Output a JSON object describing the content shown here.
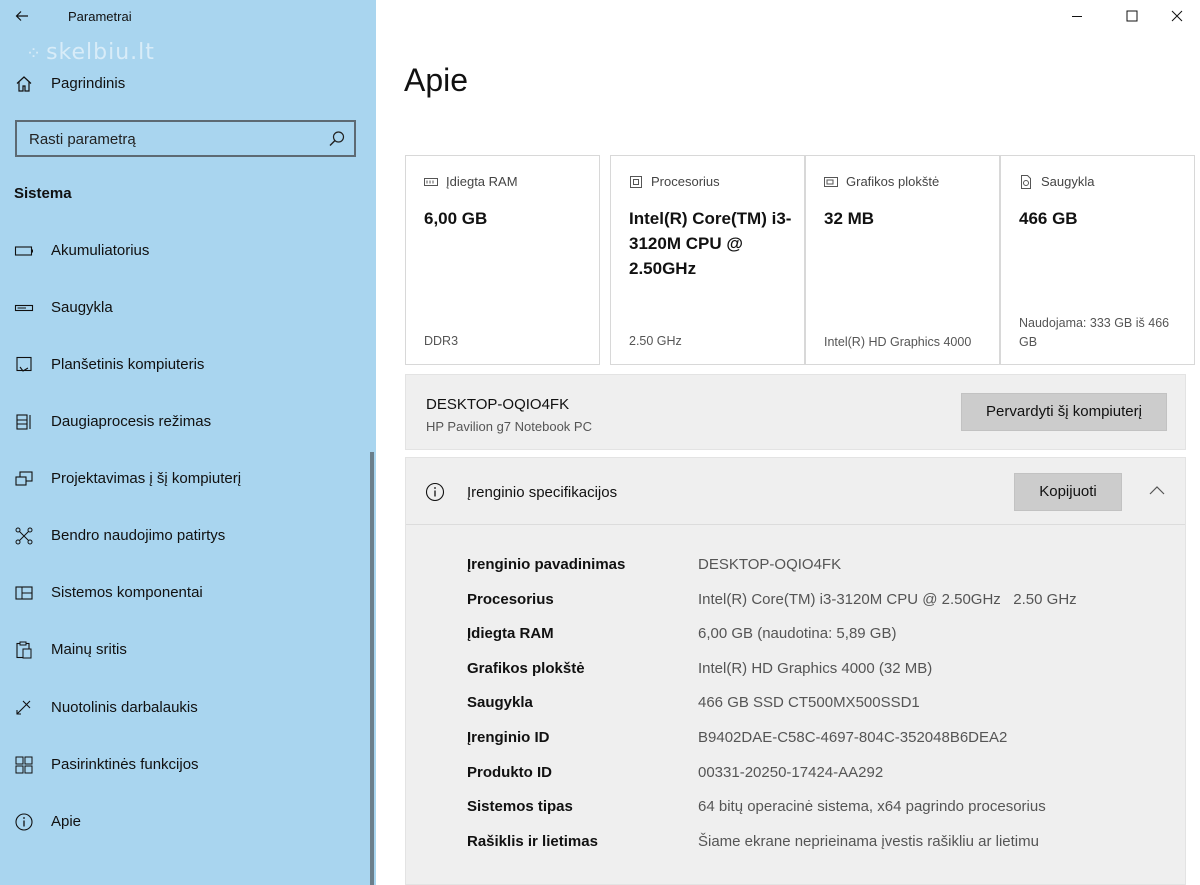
{
  "window": {
    "title": "Parametrai",
    "watermark": "skelbiu.lt",
    "minimize_icon": "minimize-icon",
    "maximize_icon": "maximize-icon",
    "close_icon": "close-icon"
  },
  "sidebar": {
    "home_label": "Pagrindinis",
    "search_placeholder": "Rasti parametrą",
    "section_title": "Sistema",
    "items": [
      {
        "label": "Akumuliatorius",
        "icon": "battery-icon"
      },
      {
        "label": "Saugykla",
        "icon": "storage-icon"
      },
      {
        "label": "Planšetinis kompiuteris",
        "icon": "tablet-icon"
      },
      {
        "label": "Daugiaprocesis režimas",
        "icon": "multitasking-icon"
      },
      {
        "label": "Projektavimas į šį kompiuterį",
        "icon": "projecting-icon"
      },
      {
        "label": "Bendro naudojimo patirtys",
        "icon": "shared-experiences-icon"
      },
      {
        "label": "Sistemos komponentai",
        "icon": "system-components-icon"
      },
      {
        "label": "Mainų sritis",
        "icon": "clipboard-icon"
      },
      {
        "label": "Nuotolinis darbalaukis",
        "icon": "remote-desktop-icon"
      },
      {
        "label": "Pasirinktinės funkcijos",
        "icon": "optional-features-icon"
      },
      {
        "label": "Apie",
        "icon": "about-icon"
      }
    ]
  },
  "main": {
    "title": "Apie",
    "cards": [
      {
        "label": "Įdiegta RAM",
        "value": "6,00 GB",
        "footer": "DDR3",
        "icon": "ram-icon"
      },
      {
        "label": "Procesorius",
        "value": "Intel(R) Core(TM) i3-3120M CPU @ 2.50GHz",
        "footer": "2.50 GHz",
        "icon": "processor-icon"
      },
      {
        "label": "Grafikos plokštė",
        "value": "32 MB",
        "footer": "Intel(R) HD Graphics 4000",
        "icon": "graphics-icon"
      },
      {
        "label": "Saugykla",
        "value": "466 GB",
        "footer": "Naudojama: 333 GB iš 466 GB",
        "icon": "storage-drive-icon"
      }
    ],
    "pc": {
      "name": "DESKTOP-OQIO4FK",
      "model": "HP Pavilion g7 Notebook PC",
      "rename_label": "Pervardyti šį kompiuterį"
    },
    "specs": {
      "title": "Įrenginio specifikacijos",
      "copy_label": "Kopijuoti",
      "rows": [
        {
          "key": "Įrenginio pavadinimas",
          "value": "DESKTOP-OQIO4FK"
        },
        {
          "key": "Procesorius",
          "value": "Intel(R) Core(TM) i3-3120M CPU @ 2.50GHz   2.50 GHz"
        },
        {
          "key": "Įdiegta RAM",
          "value": "6,00 GB (naudotina: 5,89 GB)"
        },
        {
          "key": "Grafikos plokštė",
          "value": "Intel(R) HD Graphics 4000 (32 MB)"
        },
        {
          "key": "Saugykla",
          "value": "466 GB SSD CT500MX500SSD1"
        },
        {
          "key": "Įrenginio ID",
          "value": "B9402DAE-C58C-4697-804C-352048B6DEA2"
        },
        {
          "key": "Produkto ID",
          "value": "00331-20250-17424-AA292"
        },
        {
          "key": "Sistemos tipas",
          "value": "64 bitų operacinė sistema, x64 pagrindo procesorius"
        },
        {
          "key": "Rašiklis ir lietimas",
          "value": "Šiame ekrane neprieinama įvestis rašikliu ar lietimu"
        }
      ]
    }
  }
}
